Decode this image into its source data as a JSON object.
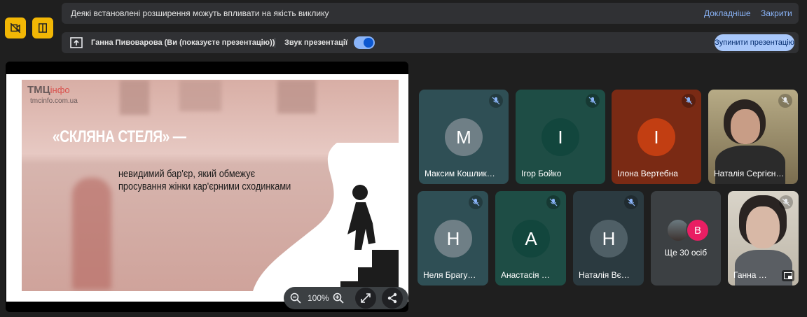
{
  "left_buttons": [
    {
      "icon": "no-video-icon"
    },
    {
      "icon": "side-panel-icon"
    }
  ],
  "extension_banner": {
    "text": "Деякі встановлені розширення можуть впливати на якість виклику",
    "details_link": "Докладніше",
    "close_link": "Закрити"
  },
  "presenting_bar": {
    "icon": "present-screen-icon",
    "text": "Ганна Пивоварова (Ви (показуєте презентацію))",
    "sound_label": "Звук презентації",
    "sound_enabled": true,
    "stop_button": "Зупинити презентацію"
  },
  "slide": {
    "logo_text": "ТМЦ",
    "logo_suffix": "інфо",
    "site": "tmcinfo.com.ua",
    "title": "«СКЛЯНА СТЕЛЯ» —",
    "subtitle_line1": "невидимий бар'єр, який обмежує",
    "subtitle_line2": "просування жінки кар'єрними сходинками"
  },
  "zoom": {
    "zoom_out_icon": "zoom-out-icon",
    "level": "100%",
    "zoom_in_icon": "zoom-in-icon",
    "fullscreen_icon": "fullscreen-icon",
    "share_icon": "share-icon"
  },
  "participants_row1": [
    {
      "name": "Максим Кошлик…",
      "initial": "М",
      "tile_color": "#2f4f55",
      "avatar_color": "#6f7f86",
      "muted": true
    },
    {
      "name": "Ігор Бойко",
      "initial": "І",
      "tile_color": "#1e4d45",
      "avatar_color": "#12463d",
      "muted": true
    },
    {
      "name": "Ілона Вертебна",
      "initial": "І",
      "tile_color": "#7a2a14",
      "avatar_color": "#c23e12",
      "muted": true
    },
    {
      "name": "Наталія Сергієн…",
      "initial": "",
      "tile_color": "#8a7a5a",
      "avatar_color": "",
      "muted": true
    }
  ],
  "participants_row2": [
    {
      "name": "Неля Брагу…",
      "initial": "Н",
      "tile_color": "#2f4f55",
      "avatar_color": "#6f7f86",
      "muted": true
    },
    {
      "name": "Анастасія …",
      "initial": "А",
      "tile_color": "#1e4d45",
      "avatar_color": "#12463d",
      "muted": true
    },
    {
      "name": "Наталія Вє…",
      "initial": "Н",
      "tile_color": "#2b3a40",
      "avatar_color": "#4f5f66",
      "muted": true
    }
  ],
  "more_tile": {
    "avatar2_initial": "В",
    "avatar2_color": "#e91e63",
    "label": "Ще 30 осіб"
  },
  "self_tile": {
    "name": "Ганна …",
    "muted": true,
    "pip_icon": "picture-in-picture-icon"
  }
}
